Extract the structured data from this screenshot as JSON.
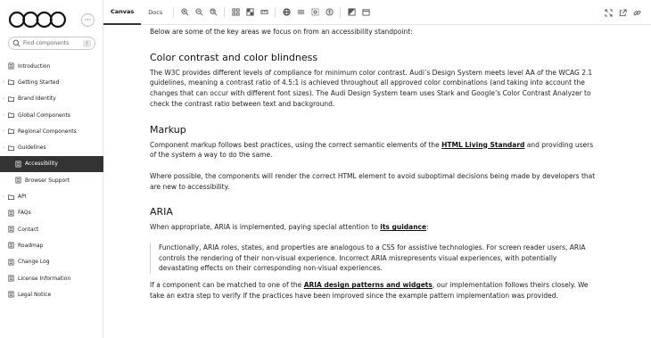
{
  "sidebar": {
    "search_placeholder": "Find components",
    "search_shortcut": "/",
    "more_label": "···",
    "items": [
      {
        "label": "Introduction",
        "type": "doc",
        "level": 0
      },
      {
        "label": "Getting Started",
        "type": "folder",
        "level": 0
      },
      {
        "label": "Brand Identity",
        "type": "folder",
        "level": 0
      },
      {
        "label": "Global Components",
        "type": "folder",
        "level": 0
      },
      {
        "label": "Regional Components",
        "type": "folder",
        "level": 0
      },
      {
        "label": "Guidelines",
        "type": "folder",
        "level": 0
      },
      {
        "label": "Accessibility",
        "type": "doc",
        "level": 1,
        "active": true
      },
      {
        "label": "Browser Support",
        "type": "doc",
        "level": 1
      },
      {
        "label": "API",
        "type": "folder",
        "level": 0
      },
      {
        "label": "FAQs",
        "type": "doc",
        "level": 0
      },
      {
        "label": "Contact",
        "type": "doc",
        "level": 0
      },
      {
        "label": "Roadmap",
        "type": "doc",
        "level": 0
      },
      {
        "label": "Change Log",
        "type": "doc",
        "level": 0
      },
      {
        "label": "License Information",
        "type": "doc",
        "level": 0
      },
      {
        "label": "Legal Notice",
        "type": "doc",
        "level": 0
      }
    ]
  },
  "toolbar": {
    "tab_canvas": "Canvas",
    "tab_docs": "Docs"
  },
  "content": {
    "intro": "Below are some of the key areas we focus on from an accessibility standpoint:",
    "h_contrast": "Color contrast and color blindness",
    "p_contrast": "The W3C provides different levels of compliance for minimum color contrast. Audi’s Design System meets level AA of the WCAG 2.1 guidelines, meaning a contrast ratio of 4.5:1 is achieved throughout all approved color combinations (and taking into account the changes that can occur with different font sizes). The Audi Design System team uses Stark and Google’s Color Contrast Analyzer to check the contrast ratio between text and background.",
    "h_markup": "Markup",
    "p_markup_pre": "Component markup follows best practices, using the correct semantic elements of the ",
    "p_markup_link": "HTML Living Standard",
    "p_markup_post": " and providing users of the system a way to do the same.",
    "p_markup2": "Where possible, the components will render the correct HTML element to avoid suboptimal decisions being made by developers that are new to accessibility.",
    "h_aria": "ARIA",
    "p_aria_pre": "When appropriate, ARIA is implemented, paying special attention to ",
    "p_aria_link": "its guidance",
    "p_aria_post": ":",
    "quote": "Functionally, ARIA roles, states, and properties are analogous to a CSS for assistive technologies. For screen reader users, ARIA controls the rendering of their non-visual experience. Incorrect ARIA misrepresents visual experiences, with potentially devastating effects on their corresponding non-visual experiences.",
    "p_aria2_pre": "If a component can be matched to one of the ",
    "p_aria2_link": "ARIA design patterns and widgets",
    "p_aria2_post": ", our implementation follows theirs closely. We take an extra step to verify if the practices have been improved since the example pattern implementation was provided."
  }
}
